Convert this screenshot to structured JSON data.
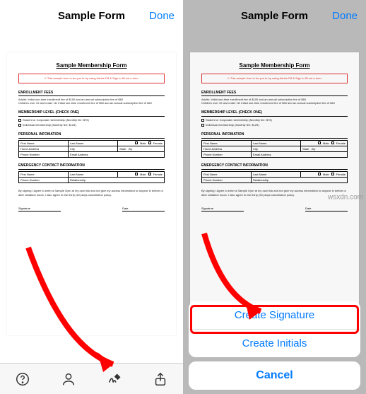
{
  "header": {
    "title": "Sample Form",
    "done": "Done"
  },
  "doc": {
    "title": "Sample Membership Form",
    "alert": "This sample form is for you to try using Adobe Fill & Sign to fill out a form.",
    "enroll_title": "ENROLLMENT FEES",
    "enroll_line1": "Adults: Initial one-time enrollment fee of $100 and an annual subscription fee of $60",
    "enroll_line2": "Children over 10 and under 18: Initial one-time enrollment fee of $50 and an annual subscription fee of $40",
    "mlevel_title": "MEMBERSHIP LEVEL (CHECK ONE)",
    "mlevel_opt1": "Student or Corporate membership (Monthly fee: $75)",
    "mlevel_opt2": "Individual membership (Monthly fee: $125)",
    "pinfo_title": "PERSONAL INFOMATION",
    "fn": "First Name",
    "ln": "Last Name",
    "male": "Male",
    "female": "Female",
    "haddr": "Home Address",
    "city": "City",
    "state": "State",
    "zip": "Zip",
    "phone": "Phone Number",
    "email": "Email Address",
    "ec_title": "EMERGENCY CONTACT INFORMATION",
    "rel": "Relationship",
    "agree": "By signing I Agree to enter a Sample Gym at my own risk and not give my access information to anyone in before or after visitation hours. I also agree to the thirty (30) days cancellation policy.",
    "sig": "Signature",
    "date": "Date"
  },
  "toolbar": {
    "help": "help-icon",
    "profile": "profile-icon",
    "sign": "sign-icon",
    "share": "share-icon"
  },
  "sheet": {
    "create_sig": "Create Signature",
    "create_init": "Create Initials",
    "cancel": "Cancel"
  },
  "watermark": "wsxdn.com"
}
